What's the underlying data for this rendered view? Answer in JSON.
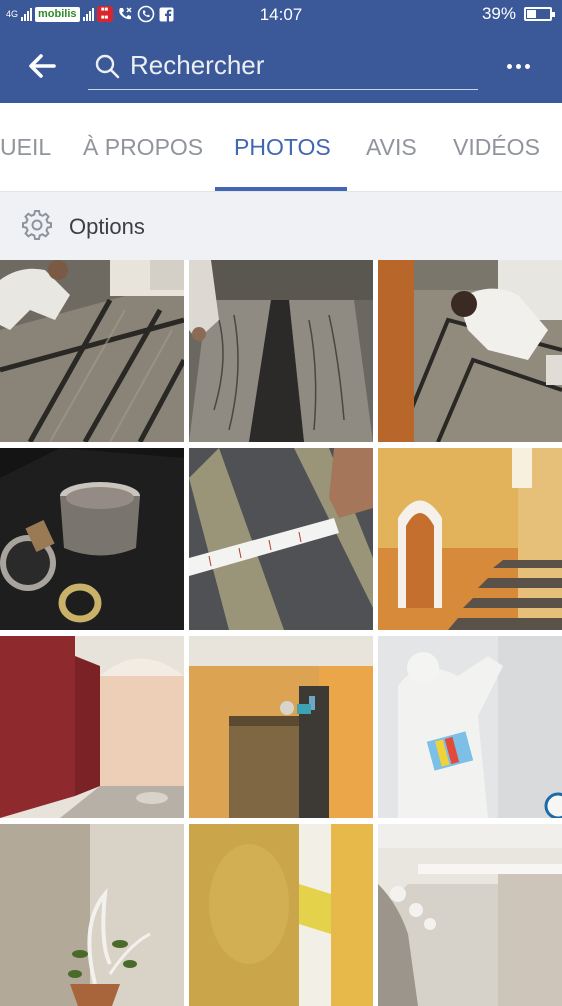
{
  "status_bar": {
    "network": "4G",
    "carrier": "mobilis",
    "time": "14:07",
    "battery_percent": "39%",
    "battery_level": 0.39
  },
  "header": {
    "search_placeholder": "Rechercher"
  },
  "tabs": [
    {
      "label": "UEIL",
      "active": false
    },
    {
      "label": "À PROPOS",
      "active": false
    },
    {
      "label": "PHOTOS",
      "active": true
    },
    {
      "label": "AVIS",
      "active": false
    },
    {
      "label": "VIDÉOS",
      "active": false
    }
  ],
  "options": {
    "label": "Options"
  },
  "colors": {
    "header_bg": "#3b5998",
    "active_tab": "#4267b2",
    "inactive_tab": "#90949c",
    "options_bg": "#f0f1f4"
  },
  "photos": [
    {
      "subject": "worker-painting-wood-floor"
    },
    {
      "subject": "wood-grain-floor-stripes"
    },
    {
      "subject": "worker-painting-floor-border"
    },
    {
      "subject": "paint-bucket-and-brushes"
    },
    {
      "subject": "measuring-tape-on-floor"
    },
    {
      "subject": "staircase-yellow-walls"
    },
    {
      "subject": "red-marble-wall"
    },
    {
      "subject": "kitchen-yellow-walls"
    },
    {
      "subject": "painter-at-wall"
    },
    {
      "subject": "plant-and-beige-wall"
    },
    {
      "subject": "yellow-textured-wall"
    },
    {
      "subject": "ceiling-moulding"
    }
  ]
}
